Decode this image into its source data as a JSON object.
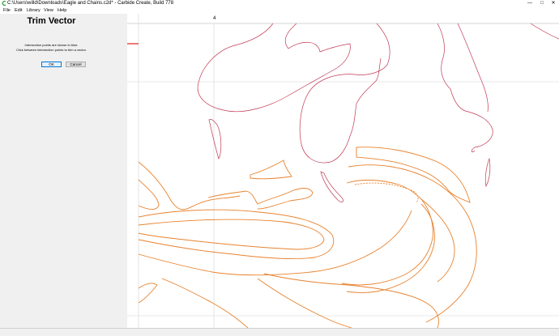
{
  "window": {
    "title": "C:\\Users\\willd\\Downloads\\Eagle and Chains.c2d* - Carbide Create, Build 778",
    "controls": {
      "minimize": "—",
      "maximize": "□",
      "close": "✕"
    }
  },
  "menu": [
    "File",
    "Edit",
    "Library",
    "View",
    "Help"
  ],
  "panel": {
    "title": "Trim Vector",
    "line1": "Intersection points are shown in blue.",
    "line2": "Click between intersection points to trim a vector.",
    "ok_label": "OK",
    "cancel_label": "Cancel"
  },
  "canvas": {
    "ruler_label": "4",
    "colors": {
      "selected_vector": "#e8822d",
      "unselected_vector": "#c03a55",
      "grid_line": "#d8d8d8",
      "origin_marker": "#e02020"
    }
  }
}
